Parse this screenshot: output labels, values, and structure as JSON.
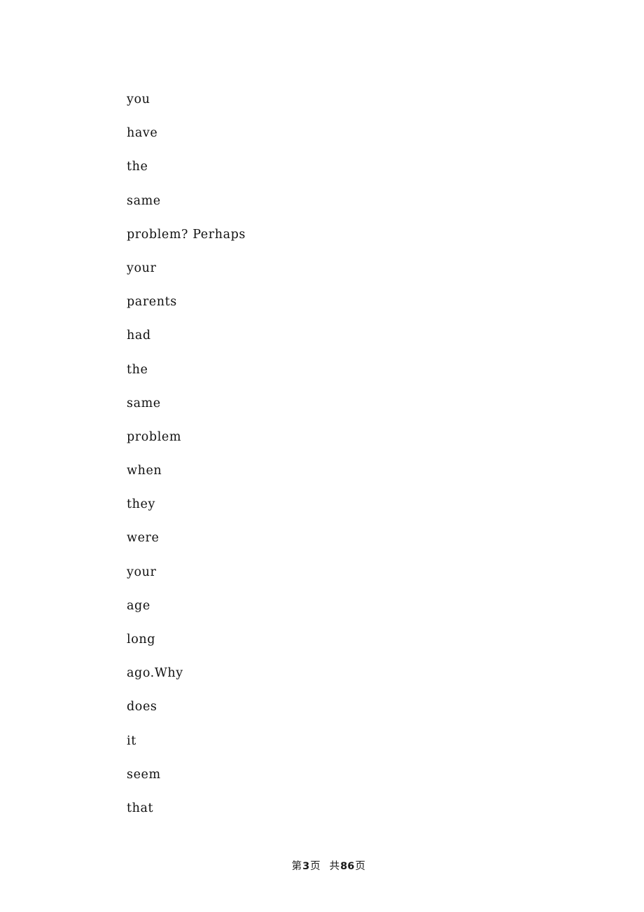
{
  "document": {
    "background_color": "#ffffff",
    "text_color": "#111111",
    "lines": [
      {
        "text": "you"
      },
      {
        "text": "have"
      },
      {
        "text": "the"
      },
      {
        "text": "same"
      },
      {
        "text": "problem? Perhaps"
      },
      {
        "text": "your"
      },
      {
        "text": "parents"
      },
      {
        "text": "had"
      },
      {
        "text": "the"
      },
      {
        "text": "same"
      },
      {
        "text": "problem"
      },
      {
        "text": "when"
      },
      {
        "text": "they"
      },
      {
        "text": "were"
      },
      {
        "text": "your"
      },
      {
        "text": "age"
      },
      {
        "text": "long"
      },
      {
        "text": "ago.Why"
      },
      {
        "text": "does"
      },
      {
        "text": "it"
      },
      {
        "text": "seem"
      },
      {
        "text": "that"
      }
    ],
    "full_text": "you have the same problem? Perhaps your parents had the same problem when they were your age long ago. Why does it seem that"
  },
  "footer": {
    "page_prefix": "第",
    "current_page": "3",
    "page_unit": "页",
    "total_prefix": "共",
    "total_pages": "86",
    "total_unit": "页",
    "full_text": "第 3 页　共 86 页"
  }
}
